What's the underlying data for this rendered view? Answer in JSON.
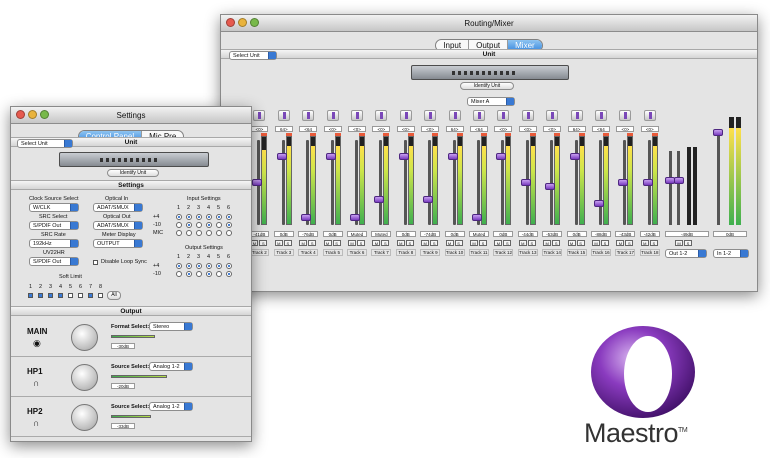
{
  "settings": {
    "title": "Settings",
    "tabs": [
      {
        "label": "Control Panel",
        "active": true
      },
      {
        "label": "Mic Pre",
        "active": false
      }
    ],
    "unit_header": "Unit",
    "select_unit": "Select Unit",
    "identify": "Identify Unit",
    "settings_header": "Settings",
    "clock_source_label": "Clock Source Select",
    "clock_source_value": "W/CLK",
    "src_select_label": "SRC Select",
    "src_select_value": "S/PDIF Out",
    "src_rate_label": "SRC Rate",
    "src_rate_value": "192kHz",
    "uv22_label": "UV22HR",
    "uv22_value": "S/PDIF Out",
    "optical_in_label": "Optical In",
    "optical_in_value": "ADAT/SMUX",
    "optical_out_label": "Optical Out",
    "optical_out_value": "ADAT/SMUX",
    "meter_display_label": "Meter Display",
    "meter_display_value": "OUTPUT",
    "disable_loop_sync": "Disable Loop Sync",
    "input_settings_label": "Input Settings",
    "output_settings_label": "Output Settings",
    "channel_numbers": [
      "1",
      "2",
      "3",
      "4",
      "5",
      "6"
    ],
    "input_rows": [
      "+4",
      "-10",
      "MIC"
    ],
    "output_rows": [
      "+4",
      "-10"
    ],
    "soft_limit_label": "Soft Limit",
    "soft_limit_numbers": [
      "1",
      "2",
      "3",
      "4",
      "5",
      "6",
      "7",
      "8"
    ],
    "soft_limit_checked": [
      true,
      true,
      true,
      true,
      false,
      false,
      true,
      false
    ],
    "all_button": "All",
    "output_header": "Output",
    "outputs": [
      {
        "name": "MAIN",
        "select_label": "Format Select:",
        "select_value": "Stereo",
        "db": "-30dB",
        "level": 0.55
      },
      {
        "name": "HP1",
        "select_label": "Source Select:",
        "select_value": "Analog 1-2",
        "db": "-20dB",
        "level": 0.7
      },
      {
        "name": "HP2",
        "select_label": "Source Select:",
        "select_value": "Analog 1-2",
        "db": "-33dB",
        "level": 0.5
      }
    ]
  },
  "mixer": {
    "title": "Routing/Mixer",
    "tabs": [
      {
        "label": "Input",
        "active": false
      },
      {
        "label": "Output",
        "active": false
      },
      {
        "label": "Mixer",
        "active": true
      }
    ],
    "unit_header": "Unit",
    "select_unit": "Select Unit",
    "identify": "Identify Unit",
    "mixer_select": "Mixer A",
    "mute_label": "M",
    "solo_label": "S",
    "tracks": [
      {
        "name": "Track 1",
        "pan": "<0>",
        "db": "0dB",
        "fader": 0.8,
        "meter": 0.55,
        "active": true
      },
      {
        "name": "Track 2",
        "pan": "<0>",
        "db": "-41dB",
        "fader": 0.5,
        "meter": 0.85,
        "active": false
      },
      {
        "name": "Track 3",
        "pan": "64>",
        "db": "0dB",
        "fader": 0.8,
        "meter": 0.9,
        "active": false
      },
      {
        "name": "Track 4",
        "pan": "<64",
        "db": "-76dB",
        "fader": 0.08,
        "meter": 0.9,
        "active": false
      },
      {
        "name": "Track 5",
        "pan": "<0>",
        "db": "0dB",
        "fader": 0.8,
        "meter": 0.9,
        "active": false
      },
      {
        "name": "Track 6",
        "pan": "<0>",
        "db": "Muted",
        "fader": 0.08,
        "meter": 0.9,
        "active": false
      },
      {
        "name": "Track 7",
        "pan": "<0>",
        "db": "Muted",
        "fader": 0.3,
        "meter": 0.9,
        "active": false
      },
      {
        "name": "Track 8",
        "pan": "<0>",
        "db": "0dB",
        "fader": 0.8,
        "meter": 0.9,
        "active": false
      },
      {
        "name": "Track 9",
        "pan": "<0>",
        "db": "-74dB",
        "fader": 0.3,
        "meter": 0.9,
        "active": false
      },
      {
        "name": "Track 10",
        "pan": "64>",
        "db": "0dB",
        "fader": 0.8,
        "meter": 0.9,
        "active": false
      },
      {
        "name": "Track 11",
        "pan": "<64",
        "db": "Muted",
        "fader": 0.08,
        "meter": 0.9,
        "active": false
      },
      {
        "name": "Track 12",
        "pan": "<0>",
        "db": "0dB",
        "fader": 0.8,
        "meter": 0.9,
        "active": false
      },
      {
        "name": "Track 13",
        "pan": "<0>",
        "db": "-44dB",
        "fader": 0.5,
        "meter": 0.9,
        "active": false
      },
      {
        "name": "Track 14",
        "pan": "<0>",
        "db": "-53dB",
        "fader": 0.45,
        "meter": 0.9,
        "active": false
      },
      {
        "name": "Track 15",
        "pan": "64>",
        "db": "0dB",
        "fader": 0.8,
        "meter": 0.9,
        "active": false
      },
      {
        "name": "Track 16",
        "pan": "<64",
        "db": "-88dB",
        "fader": 0.25,
        "meter": 0.9,
        "active": false
      },
      {
        "name": "Track 17",
        "pan": "<0>",
        "db": "-43dB",
        "fader": 0.5,
        "meter": 0.9,
        "active": false
      },
      {
        "name": "Track 18",
        "pan": "<0>",
        "db": "-42dB",
        "fader": 0.5,
        "meter": 0.9,
        "active": false
      }
    ],
    "out_bus": {
      "db": "-49dB",
      "select": "Out 1-2"
    },
    "in_bus": {
      "db": "0dB",
      "select": "In 1-2"
    }
  },
  "logo": {
    "text": "Maestro",
    "tm": "TM",
    "color": "#7a2a9a"
  }
}
